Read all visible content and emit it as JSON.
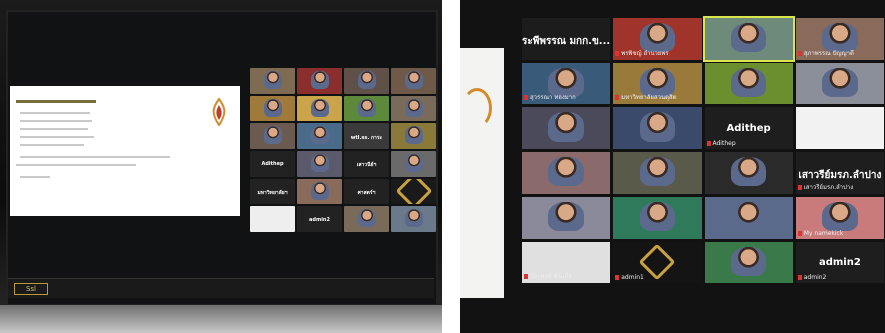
{
  "left_photo": {
    "taskbar_logo": "Ssl",
    "grid_tiles": [
      {
        "label": "",
        "bg": "#7f6a52"
      },
      {
        "label": "",
        "bg": "#8b2e2e"
      },
      {
        "label": "",
        "bg": "#5f5048"
      },
      {
        "label": "",
        "bg": "#6f5a4a"
      },
      {
        "label": "",
        "bg": "#a07a3a"
      },
      {
        "label": "",
        "bg": "#c9a44a"
      },
      {
        "label": "",
        "bg": "#5c8a3a"
      },
      {
        "label": "",
        "bg": "#7a6a5a"
      },
      {
        "label": "",
        "bg": "#6a5a50"
      },
      {
        "label": "",
        "bg": "#4a6a8a"
      },
      {
        "label": "",
        "bg": "#3a3a3a",
        "name": "wtl.ss. การะ"
      },
      {
        "label": "",
        "bg": "#8a7a3a"
      },
      {
        "label": "",
        "bg": "#222222",
        "name": "Adithep"
      },
      {
        "label": "",
        "bg": "#5a5a6a"
      },
      {
        "label": "",
        "bg": "#222222",
        "name": "เสาวนีย์ฯ"
      },
      {
        "label": "",
        "bg": "#6a6a6a"
      },
      {
        "label": "",
        "bg": "#222222",
        "name": "มหาวิทยาลัยฯ"
      },
      {
        "label": "",
        "bg": "#8a6a5a"
      },
      {
        "label": "",
        "bg": "#222222",
        "name": "ศาสตร์ฯ"
      },
      {
        "label": "",
        "bg": "#1a1a1a",
        "emblem": true
      },
      {
        "label": "",
        "bg": "#eeeeee"
      },
      {
        "label": "",
        "bg": "#222222",
        "name": "admin2"
      },
      {
        "label": "",
        "bg": "#7a6a5a"
      },
      {
        "label": "",
        "bg": "#6a7a8a"
      }
    ]
  },
  "right_photo": {
    "tiles": [
      {
        "name": "ระพีพรรณ มกก.ข...",
        "label": "",
        "bg": "#1c1c1c"
      },
      {
        "name": "",
        "label": "พรพิชญ์ อำนวยพร",
        "bg": "#a0342a"
      },
      {
        "name": "",
        "label": "",
        "bg": "#6d8a7a",
        "hl": true
      },
      {
        "name": "",
        "label": "สุภาพรรณ ปัญญาดี",
        "bg": "#8a6a5a"
      },
      {
        "name": "",
        "label": "สุวรรณา ทองมาก",
        "bg": "#3a5a7a"
      },
      {
        "name": "",
        "label": "มหาวิทยาลัยสวนดุสิต",
        "bg": "#9a7a3a"
      },
      {
        "name": "",
        "label": "",
        "bg": "#6b8f2f"
      },
      {
        "name": "",
        "label": "",
        "bg": "#8a8f9a"
      },
      {
        "name": "",
        "label": "",
        "bg": "#4a4a5a"
      },
      {
        "name": "",
        "label": "",
        "bg": "#3a4a6a"
      },
      {
        "name": "Adithep",
        "label": "Adithep",
        "bg": "#1e1e1e"
      },
      {
        "name": "",
        "label": "",
        "bg": "#f2f2f2"
      },
      {
        "name": "",
        "label": "",
        "bg": "#8a6a6a"
      },
      {
        "name": "",
        "label": "",
        "bg": "#5a5a4a"
      },
      {
        "name": "",
        "label": "",
        "bg": "#2a2a2a"
      },
      {
        "name": "เสาวรีย์มรภ.ลำปาง",
        "label": "เสาวรีย์มรภ.ลำปาง",
        "bg": "#1e1e1e"
      },
      {
        "name": "",
        "label": "",
        "bg": "#8a8a9a"
      },
      {
        "name": "",
        "label": "",
        "bg": "#2f7a5a"
      },
      {
        "name": "",
        "label": "",
        "bg": "#5a6a8a"
      },
      {
        "name": "",
        "label": "My namekick",
        "bg": "#c97a7a"
      },
      {
        "name": "",
        "label": "ปิยะพงษ์ คำแก้ว",
        "bg": "#e0e0e0"
      },
      {
        "name": "",
        "label": "admin1",
        "bg": "#141414",
        "emblem": true
      },
      {
        "name": "",
        "label": "",
        "bg": "#3a7a4a"
      },
      {
        "name": "admin2",
        "label": "admin2",
        "bg": "#1e1e1e"
      }
    ]
  }
}
